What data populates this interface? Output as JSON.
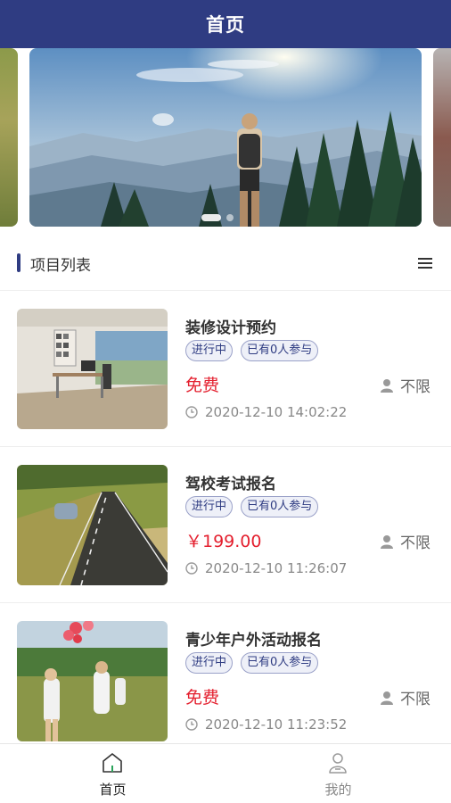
{
  "header": {
    "title": "首页"
  },
  "banner": {
    "slide_count": 2,
    "active_index": 0
  },
  "section": {
    "title": "项目列表",
    "menu_icon": "list-menu-icon"
  },
  "items": [
    {
      "title": "装修设计预约",
      "status_tag": "进行中",
      "participants_tag": "已有0人参与",
      "price": "免费",
      "people_limit": "不限",
      "time": "2020-12-10 14:02:22"
    },
    {
      "title": "驾校考试报名",
      "status_tag": "进行中",
      "participants_tag": "已有0人参与",
      "price": "￥199.00",
      "people_limit": "不限",
      "time": "2020-12-10 11:26:07"
    },
    {
      "title": "青少年户外活动报名",
      "status_tag": "进行中",
      "participants_tag": "已有0人参与",
      "price": "免费",
      "people_limit": "不限",
      "time": "2020-12-10 11:23:52"
    }
  ],
  "tabbar": {
    "tabs": [
      {
        "label": "首页",
        "icon": "home-icon",
        "active": true
      },
      {
        "label": "我的",
        "icon": "user-icon",
        "active": false
      }
    ]
  },
  "colors": {
    "brand": "#2f3c82",
    "price_red": "#e4202f",
    "tag_border": "#9aa1c8",
    "tag_bg": "#eef0f8"
  }
}
